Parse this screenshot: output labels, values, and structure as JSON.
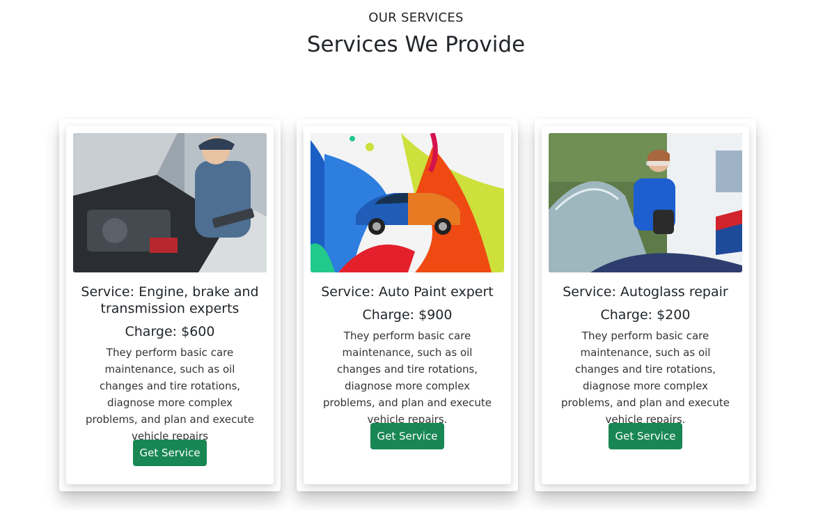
{
  "section": {
    "eyebrow": "OUR SERVICES",
    "title": "Services We Provide"
  },
  "colors": {
    "button": "#198754",
    "text": "#212529"
  },
  "services": [
    {
      "title": "Service: Engine, brake and transmission experts",
      "charge": "Charge: $600",
      "description": "They perform basic care maintenance, such as oil changes and tire rotations, diagnose more complex problems, and plan and execute vehicle repairs",
      "button": "Get Service",
      "image": "mechanic-engine-photo"
    },
    {
      "title": "Service: Auto Paint expert",
      "charge": "Charge: $900",
      "description": "They perform basic care maintenance, such as oil changes and tire rotations, diagnose more complex problems, and plan and execute vehicle repairs.",
      "button": "Get Service",
      "image": "car-paint-splash-photo"
    },
    {
      "title": "Service: Autoglass repair",
      "charge": "Charge: $200",
      "description": "They perform basic care maintenance, such as oil changes and tire rotations, diagnose more complex problems, and plan and execute vehicle repairs.",
      "button": "Get Service",
      "image": "windshield-repair-photo"
    }
  ]
}
